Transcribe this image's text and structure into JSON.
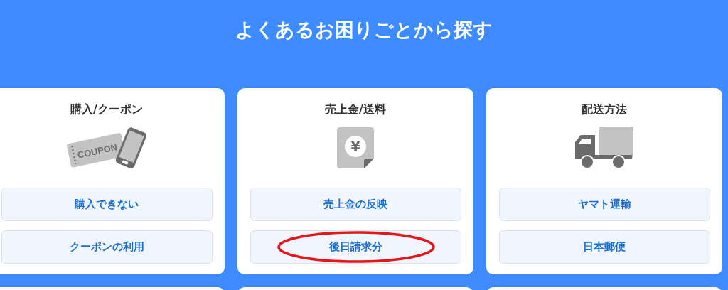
{
  "heading": "よくあるお困りごとから探す",
  "categories": [
    {
      "title": "購入/クーポン",
      "kind": "coupon",
      "icon_label": "COUPON",
      "links": [
        {
          "label": "購入できない",
          "circled": false
        },
        {
          "label": "クーポンの利用",
          "circled": false
        }
      ]
    },
    {
      "title": "売上金/送料",
      "kind": "yen",
      "icon_label": "¥",
      "links": [
        {
          "label": "売上金の反映",
          "circled": false
        },
        {
          "label": "後日請求分",
          "circled": true
        }
      ]
    },
    {
      "title": "配送方法",
      "kind": "truck",
      "links": [
        {
          "label": "ヤマト運輸",
          "circled": false
        },
        {
          "label": "日本郵便",
          "circled": false
        }
      ]
    }
  ]
}
